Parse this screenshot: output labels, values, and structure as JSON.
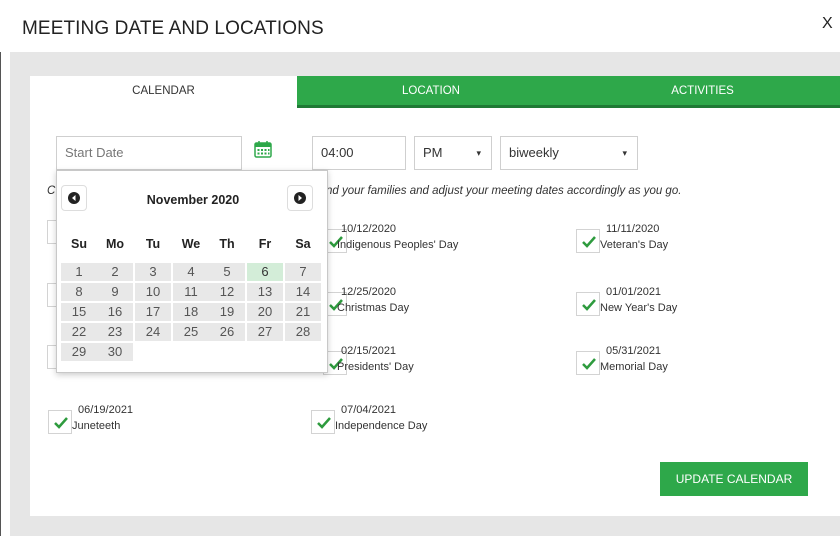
{
  "header": {
    "title": "MEETING DATE AND LOCATIONS",
    "close_label": "X"
  },
  "tabs": [
    {
      "label": "CALENDAR",
      "active": true
    },
    {
      "label": "LOCATION",
      "active": false
    },
    {
      "label": "ACTIVITIES",
      "active": false
    }
  ],
  "form": {
    "start_date_placeholder": "Start Date",
    "time_value": "04:00",
    "ampm_value": "PM",
    "frequency_value": "biweekly"
  },
  "info": {
    "prefix": "C",
    "text": "nd your families and adjust your meeting dates accordingly as you go."
  },
  "holidays": [
    {
      "date": "10/12/2020",
      "name": "Indigenous Peoples' Day",
      "checked": true
    },
    {
      "date": "11/11/2020",
      "name": "Veteran's Day",
      "checked": true
    },
    {
      "date": "12/25/2020",
      "name": "Christmas Day",
      "checked": true
    },
    {
      "date": "01/01/2021",
      "name": "New Year's Day",
      "checked": true
    },
    {
      "date": "02/15/2021",
      "name": "Presidents' Day",
      "checked": true
    },
    {
      "date": "05/31/2021",
      "name": "Memorial Day",
      "checked": true
    },
    {
      "date": "06/19/2021",
      "name": "Juneteeth",
      "checked": true
    },
    {
      "date": "07/04/2021",
      "name": "Independence Day",
      "checked": true
    }
  ],
  "update_button": "UPDATE CALENDAR",
  "datepicker": {
    "title": "November 2020",
    "days_of_week": [
      "Su",
      "Mo",
      "Tu",
      "We",
      "Th",
      "Fr",
      "Sa"
    ],
    "weeks": [
      [
        "1",
        "2",
        "3",
        "4",
        "5",
        "6",
        "7"
      ],
      [
        "8",
        "9",
        "10",
        "11",
        "12",
        "13",
        "14"
      ],
      [
        "15",
        "16",
        "17",
        "18",
        "19",
        "20",
        "21"
      ],
      [
        "22",
        "23",
        "24",
        "25",
        "26",
        "27",
        "28"
      ],
      [
        "29",
        "30"
      ]
    ],
    "highlighted_day": "6"
  },
  "colors": {
    "accent": "#2ea84a",
    "check": "#2e9b3e",
    "today": "#d3edd8"
  }
}
